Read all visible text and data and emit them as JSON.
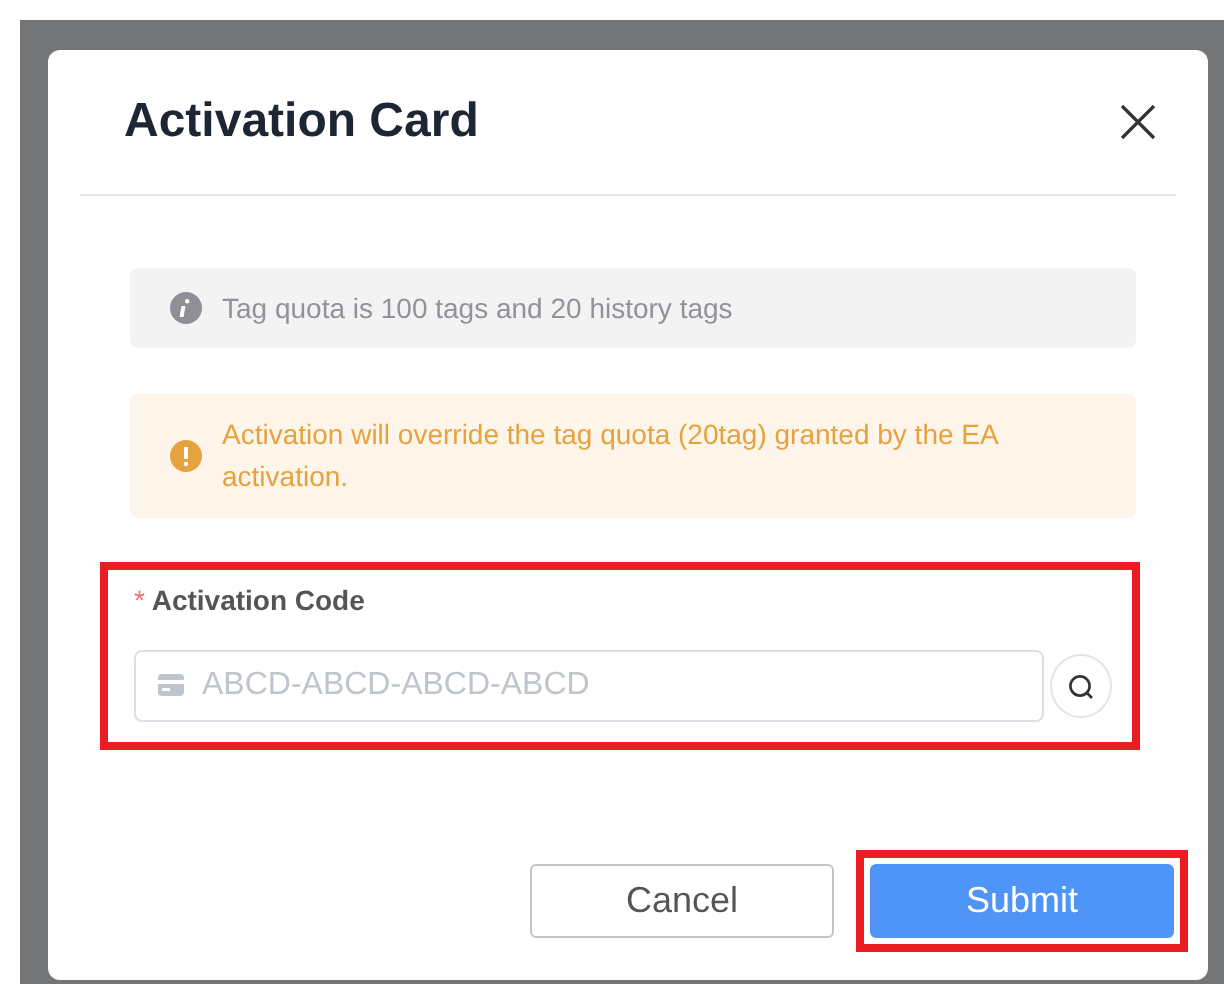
{
  "dialog": {
    "title": "Activation Card"
  },
  "info": {
    "text": "Tag quota is 100 tags and 20 history tags"
  },
  "warning": {
    "text": "Activation will override the tag quota (20tag) granted by the EA activation."
  },
  "field": {
    "label": "Activation Code",
    "required_mark": "*",
    "placeholder": "ABCD-ABCD-ABCD-ABCD",
    "highlighted": true
  },
  "buttons": [
    {
      "label": "Cancel",
      "kind": "secondary",
      "highlighted": false
    },
    {
      "label": "Submit",
      "kind": "primary",
      "highlighted": true
    }
  ]
}
